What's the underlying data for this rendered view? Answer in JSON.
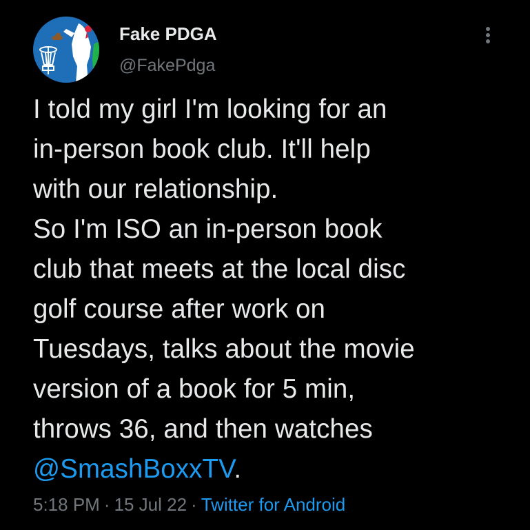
{
  "author": {
    "display_name": "Fake PDGA",
    "handle": "@FakePdga"
  },
  "menu": {
    "icon": "more-vertical-icon"
  },
  "tweet": {
    "lines": [
      "I told my girl I'm looking for an",
      "in-person book club. It'll help",
      "with our relationship.",
      "So I'm ISO an in-person book",
      "club that meets at the local disc",
      "golf course after work on",
      "Tuesdays, talks about the movie",
      "version of a book for 5 min,",
      "throws 36, and then watches"
    ],
    "mention": "@SmashBoxxTV",
    "trailing": "."
  },
  "meta": {
    "time": "5:18 PM",
    "separator": "·",
    "date": "15 Jul 22",
    "source": "Twitter for Android"
  },
  "colors": {
    "background": "#000000",
    "text": "#e7e9ea",
    "secondary": "#71767b",
    "link": "#1d9bf0",
    "avatar_bg": "#1f6fb8"
  }
}
